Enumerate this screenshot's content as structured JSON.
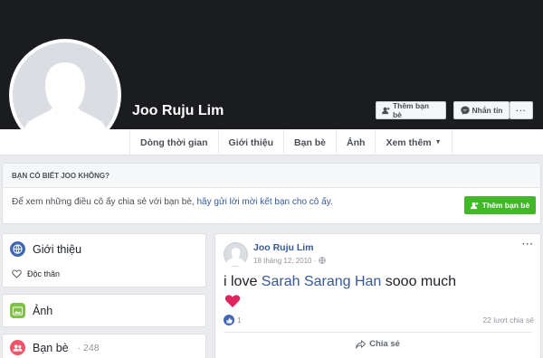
{
  "profile": {
    "name": "Joo Ruju Lim",
    "add_friend_label": "Thêm bạn bè",
    "message_label": "Nhắn tin",
    "more_label": "···"
  },
  "nav": {
    "tabs": [
      {
        "label": "Dòng thời gian"
      },
      {
        "label": "Giới thiệu"
      },
      {
        "label": "Bạn bè"
      },
      {
        "label": "Ảnh"
      },
      {
        "label": "Xem thêm"
      }
    ]
  },
  "know": {
    "heading": "BẠN CÓ BIẾT JOO KHÔNG?",
    "text": "Để xem những điều cô ấy chia sẻ với bạn bè, ",
    "link": "hãy gửi lời mời kết bạn cho cô ấy.",
    "button": "Thêm bạn bè"
  },
  "sidebar": {
    "intro_title": "Giới thiệu",
    "intro_item": "Độc thân",
    "photos_title": "Ảnh",
    "friends_title": "Bạn bè",
    "friends_count": "· 248"
  },
  "post": {
    "author": "Joo Ruju Lim",
    "date": "18 tháng 12, 2010 · ",
    "text_before": "i love ",
    "text_link": "Sarah Sarang Han",
    "text_after": " sooo much",
    "like_count": "1",
    "shares": "22 lượt chia sẻ",
    "share_label": "Chia sẻ",
    "menu_label": "···"
  },
  "colors": {
    "cover": "#1b1c1f",
    "link": "#365899",
    "green": "#42b72a",
    "like": "#4267b2",
    "heart": "#e0245e"
  }
}
